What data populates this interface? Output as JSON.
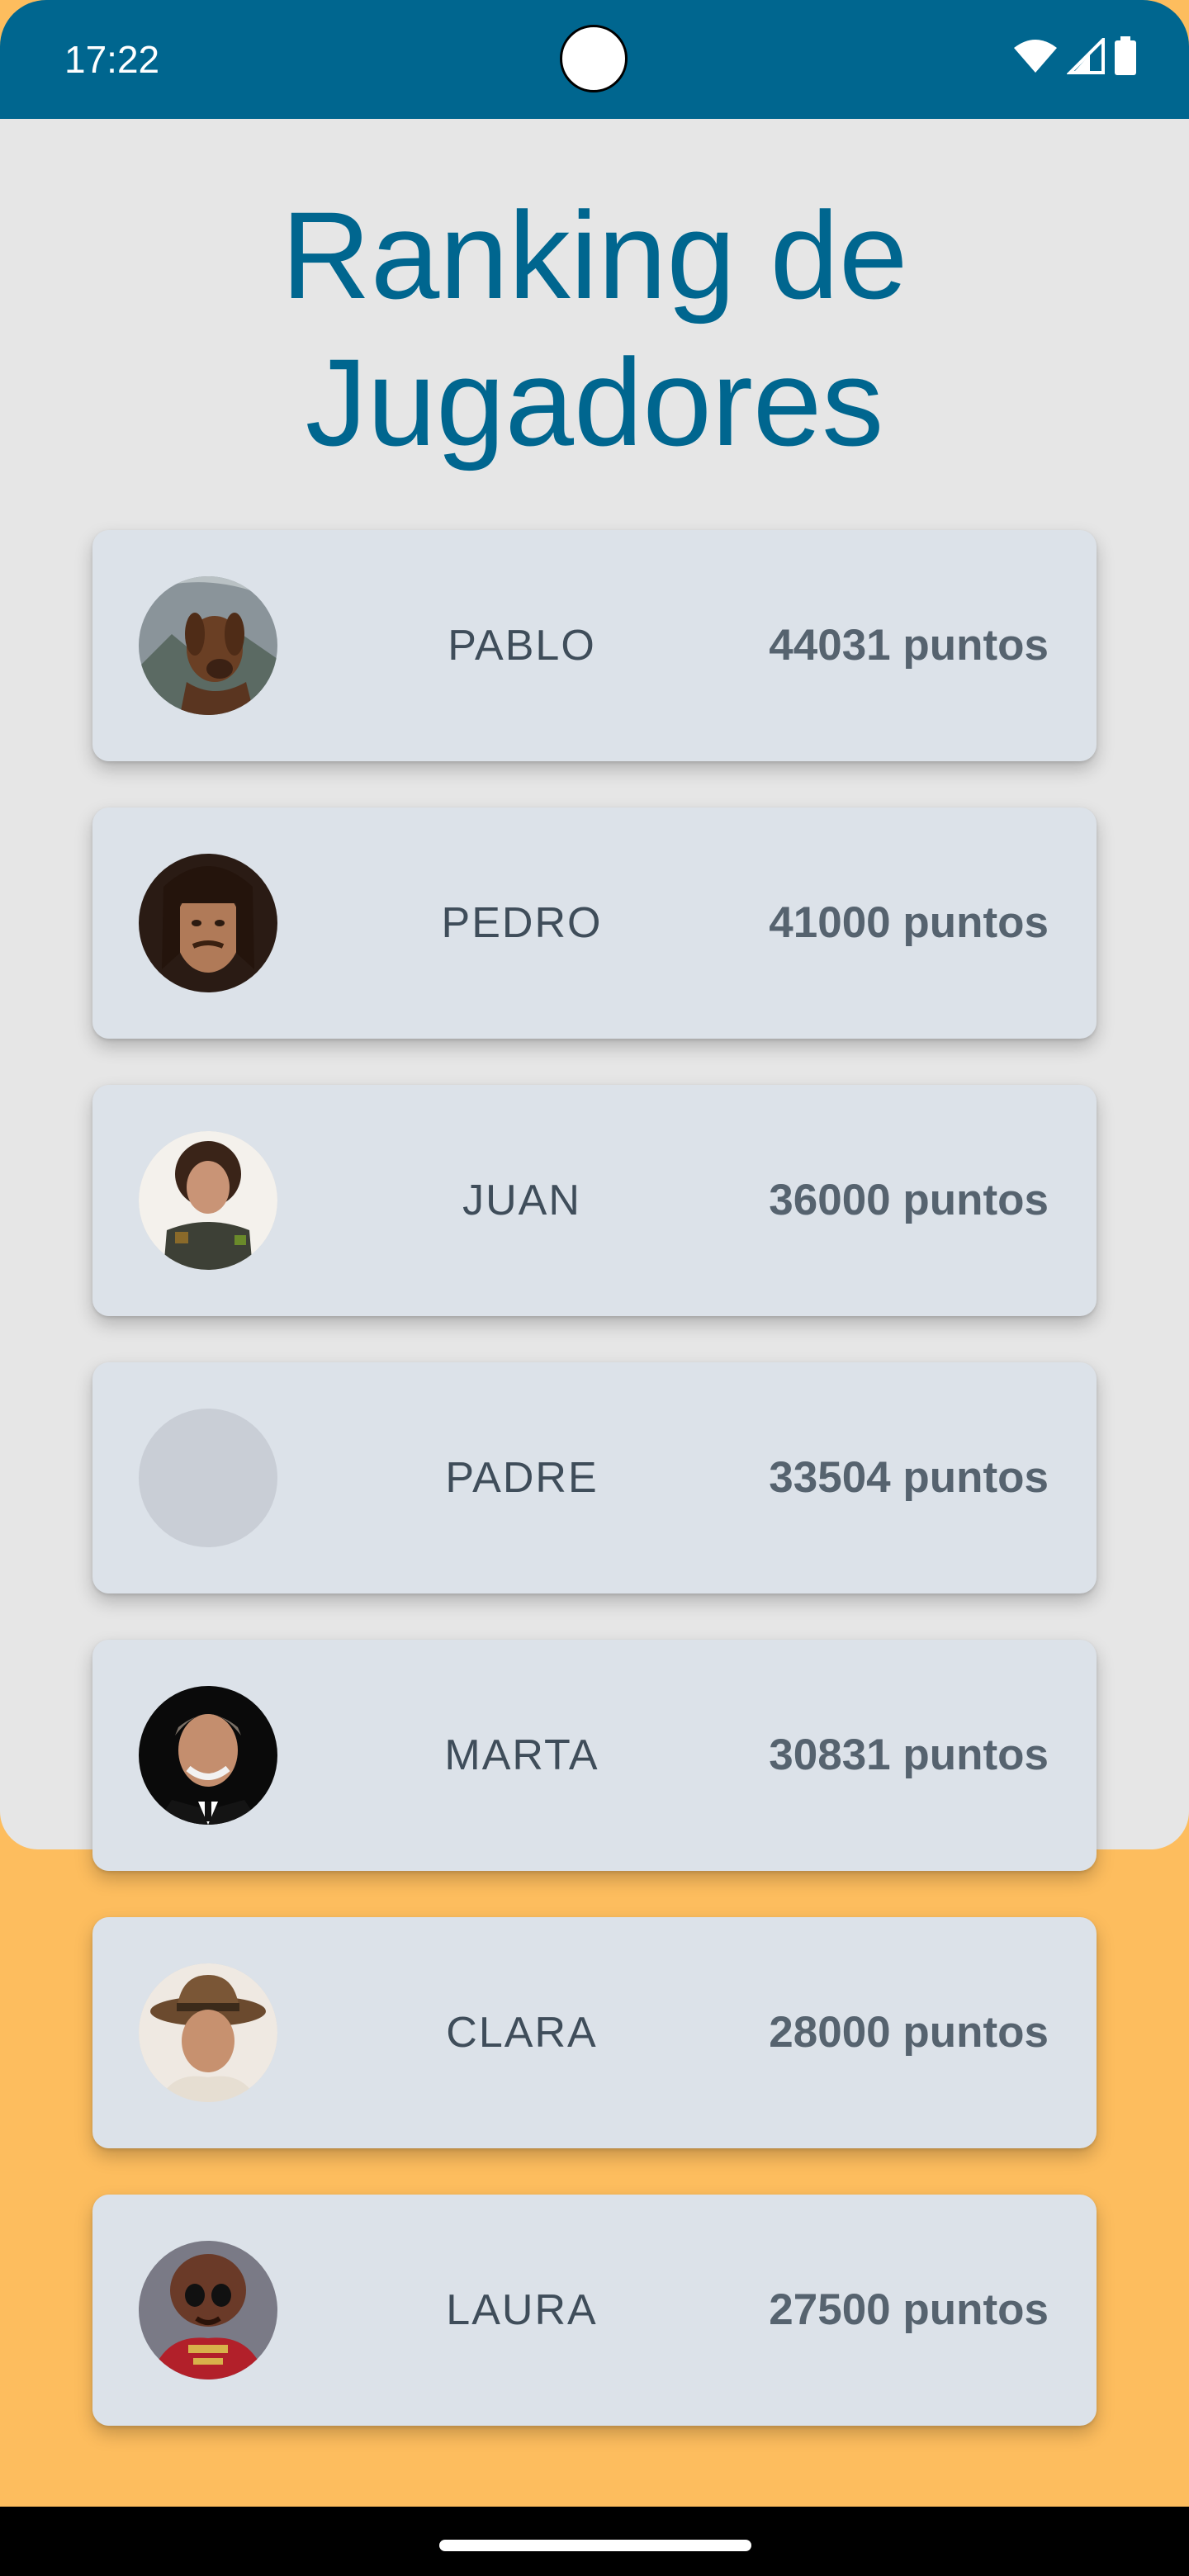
{
  "status_bar": {
    "time": "17:22",
    "icons": [
      "wifi-icon",
      "signal-icon",
      "battery-icon"
    ],
    "background_color": "#00668f"
  },
  "page": {
    "title": "Ranking de Jugadores",
    "title_color": "#00668f",
    "panel_color": "#e6e6e6",
    "background_color": "#fdbd5e"
  },
  "players": [
    {
      "name": "PABLO",
      "score": "44031 puntos",
      "avatar": "dog-portrait"
    },
    {
      "name": "PEDRO",
      "score": "41000 puntos",
      "avatar": "man-mustache-portrait"
    },
    {
      "name": "JUAN",
      "score": "36000 puntos",
      "avatar": "woman-curly-hair-portrait"
    },
    {
      "name": "PADRE",
      "score": "33504 puntos",
      "avatar": "empty-placeholder"
    },
    {
      "name": "MARTA",
      "score": "30831 puntos",
      "avatar": "man-suit-portrait"
    },
    {
      "name": "CLARA",
      "score": "28000 puntos",
      "avatar": "man-fedora-portrait"
    },
    {
      "name": "LAURA",
      "score": "27500 puntos",
      "avatar": "alien-character-portrait"
    }
  ],
  "card_color": "#dce2e9"
}
